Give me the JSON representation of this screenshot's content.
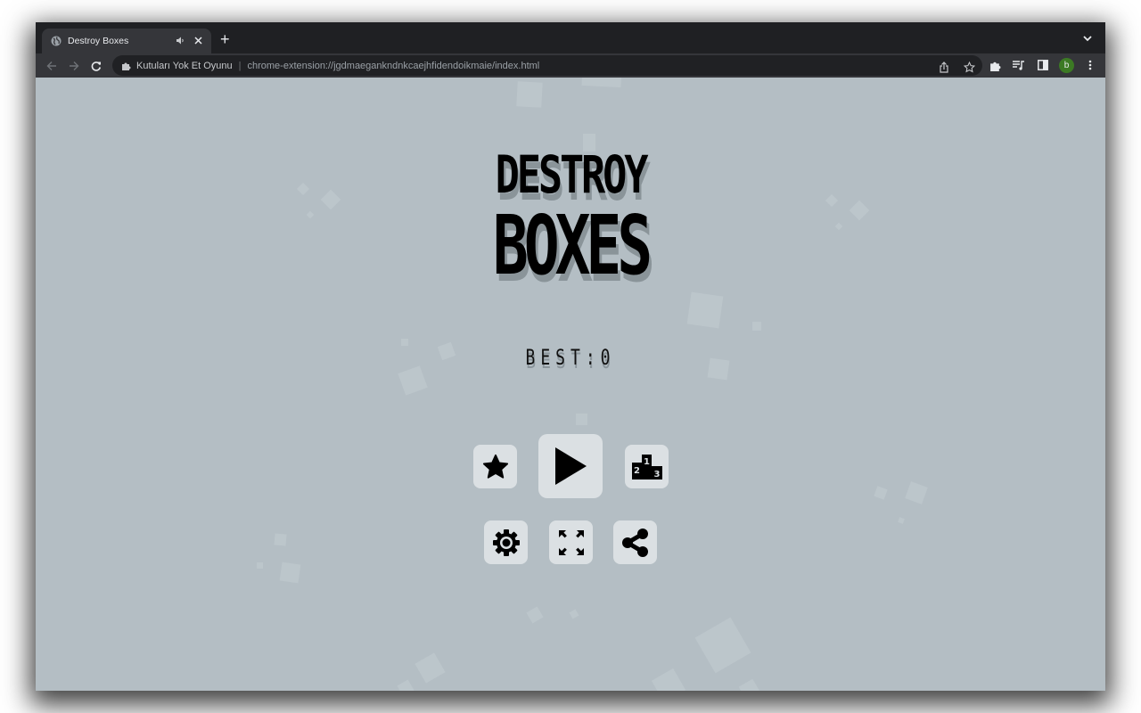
{
  "browser": {
    "tab": {
      "title": "Destroy Boxes",
      "favicon": "globe-icon",
      "audio_icon": "speaker-icon",
      "close_icon": "close-icon"
    },
    "new_tab_label": "+",
    "tab_menu_icon": "chevron-down-icon",
    "nav": {
      "back_icon": "arrow-left-icon",
      "forward_icon": "arrow-right-icon",
      "reload_icon": "reload-icon"
    },
    "omnibox": {
      "site_name": "Kutuları Yok Et Oyunu",
      "separator": "|",
      "url": "chrome-extension://jgdmaegankndnkcaejhfidendoikmaie/index.html"
    },
    "toolbar_icons": [
      "share-icon",
      "star-icon",
      "extensions-icon",
      "media-queue-icon",
      "side-panel-icon",
      "profile-avatar",
      "menu-icon"
    ],
    "profile_initial": "b",
    "profile_color": "#3c7a24"
  },
  "game": {
    "title_line1": "DESTROY",
    "title_line2": "BOXES",
    "best_label": "BEST:",
    "best_score": "0",
    "background_color": "#b4bec4",
    "button_color": "#dbe0e3",
    "buttons": {
      "rate": "star-icon",
      "play": "play-icon",
      "leaderboard": "podium-icon",
      "leaderboard_digits": [
        "1",
        "2",
        "3"
      ],
      "settings": "gear-icon",
      "fullscreen": "fullscreen-icon",
      "share": "share-icon"
    }
  }
}
